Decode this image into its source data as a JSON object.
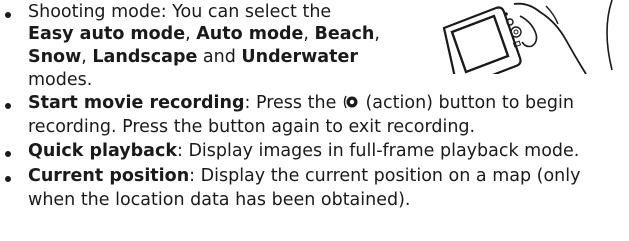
{
  "bullets": [
    {
      "lines": [
        [
          {
            "t": "Shooting mode: You can select the",
            "b": false
          }
        ],
        [
          {
            "t": "Easy auto mode",
            "b": true
          },
          {
            "t": ", ",
            "b": false
          },
          {
            "t": "Auto mode",
            "b": true
          },
          {
            "t": ", ",
            "b": false
          },
          {
            "t": "Beach",
            "b": true
          },
          {
            "t": ",",
            "b": false
          }
        ],
        [
          {
            "t": "Snow",
            "b": true
          },
          {
            "t": ", ",
            "b": false
          },
          {
            "t": "Landscape",
            "b": true
          },
          {
            "t": " and ",
            "b": false
          },
          {
            "t": "Underwater",
            "b": true
          }
        ],
        [
          {
            "t": "modes.",
            "b": false
          }
        ]
      ]
    },
    {
      "lines": [
        [
          {
            "t": "Start movie recording",
            "b": true
          },
          {
            "t": ": Press the ",
            "b": false
          },
          {
            "icon": "action-button-icon"
          },
          {
            "t": " (action) button to begin",
            "b": false
          }
        ],
        [
          {
            "t": "recording. Press the button again to exit recording.",
            "b": false
          }
        ]
      ]
    },
    {
      "lines": [
        [
          {
            "t": "Quick playback",
            "b": true
          },
          {
            "t": ": Display images in full-frame playback mode.",
            "b": false
          }
        ]
      ]
    },
    {
      "lines": [
        [
          {
            "t": "Current position",
            "b": true
          },
          {
            "t": ": Display the current position on a map (only",
            "b": false
          }
        ],
        [
          {
            "t": "when the location data has been obtained).",
            "b": false
          }
        ]
      ]
    }
  ],
  "illustration": {
    "icon": "camera-in-hand-illustration"
  }
}
